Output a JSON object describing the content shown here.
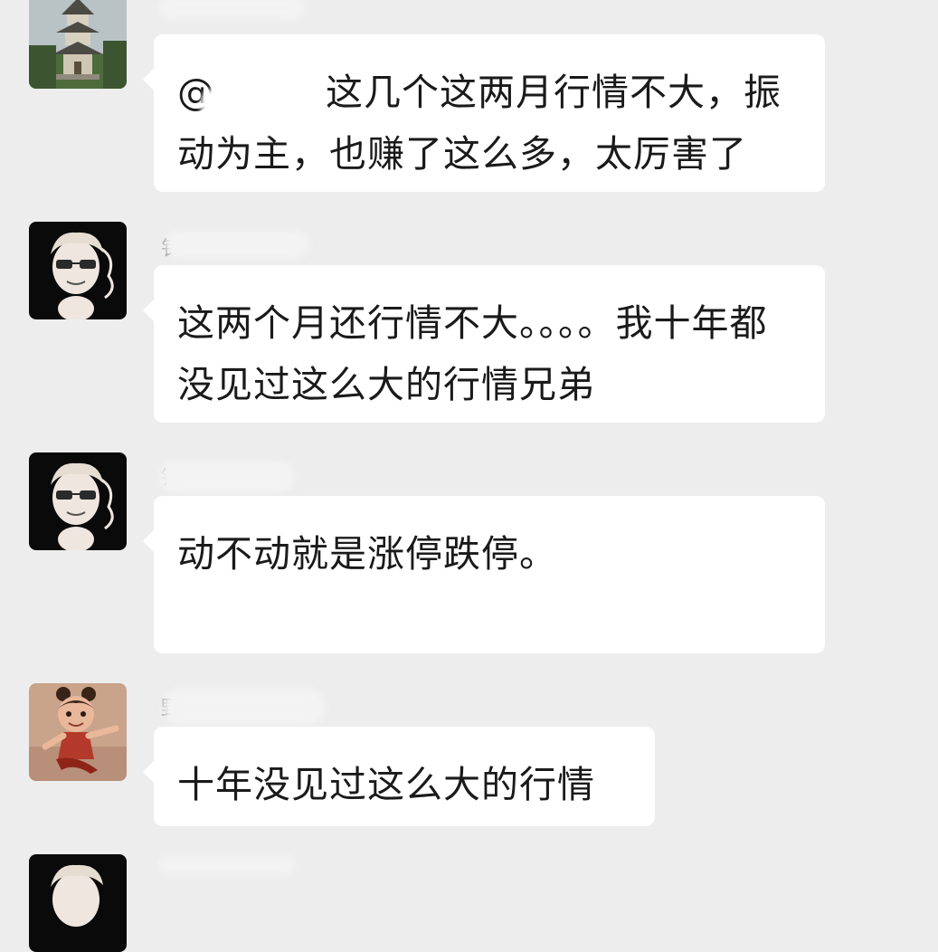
{
  "messages": [
    {
      "avatar": "pagoda-avatar",
      "sender_fragment": "",
      "mention": "@",
      "text": "这几个这两月行情不大，振动为主，也赚了这么多，太厉害了"
    },
    {
      "avatar": "cartoon-man-sunglasses-avatar",
      "sender_fragment": "钅",
      "text": "这两个月还行情不大。。。。我十年都没见过这么大的行情兄弟"
    },
    {
      "avatar": "cartoon-man-sunglasses-avatar",
      "sender_fragment": "钬",
      "text": "动不动就是涨停跌停。"
    },
    {
      "avatar": "nezha-avatar",
      "sender_fragment": "野",
      "text": "十年没见过这么大的行情"
    },
    {
      "avatar": "cartoon-man-sunglasses-avatar",
      "sender_fragment": "",
      "text": ""
    }
  ],
  "colors": {
    "background": "#ededed",
    "bubble": "#ffffff",
    "text": "#1a1a1a"
  }
}
